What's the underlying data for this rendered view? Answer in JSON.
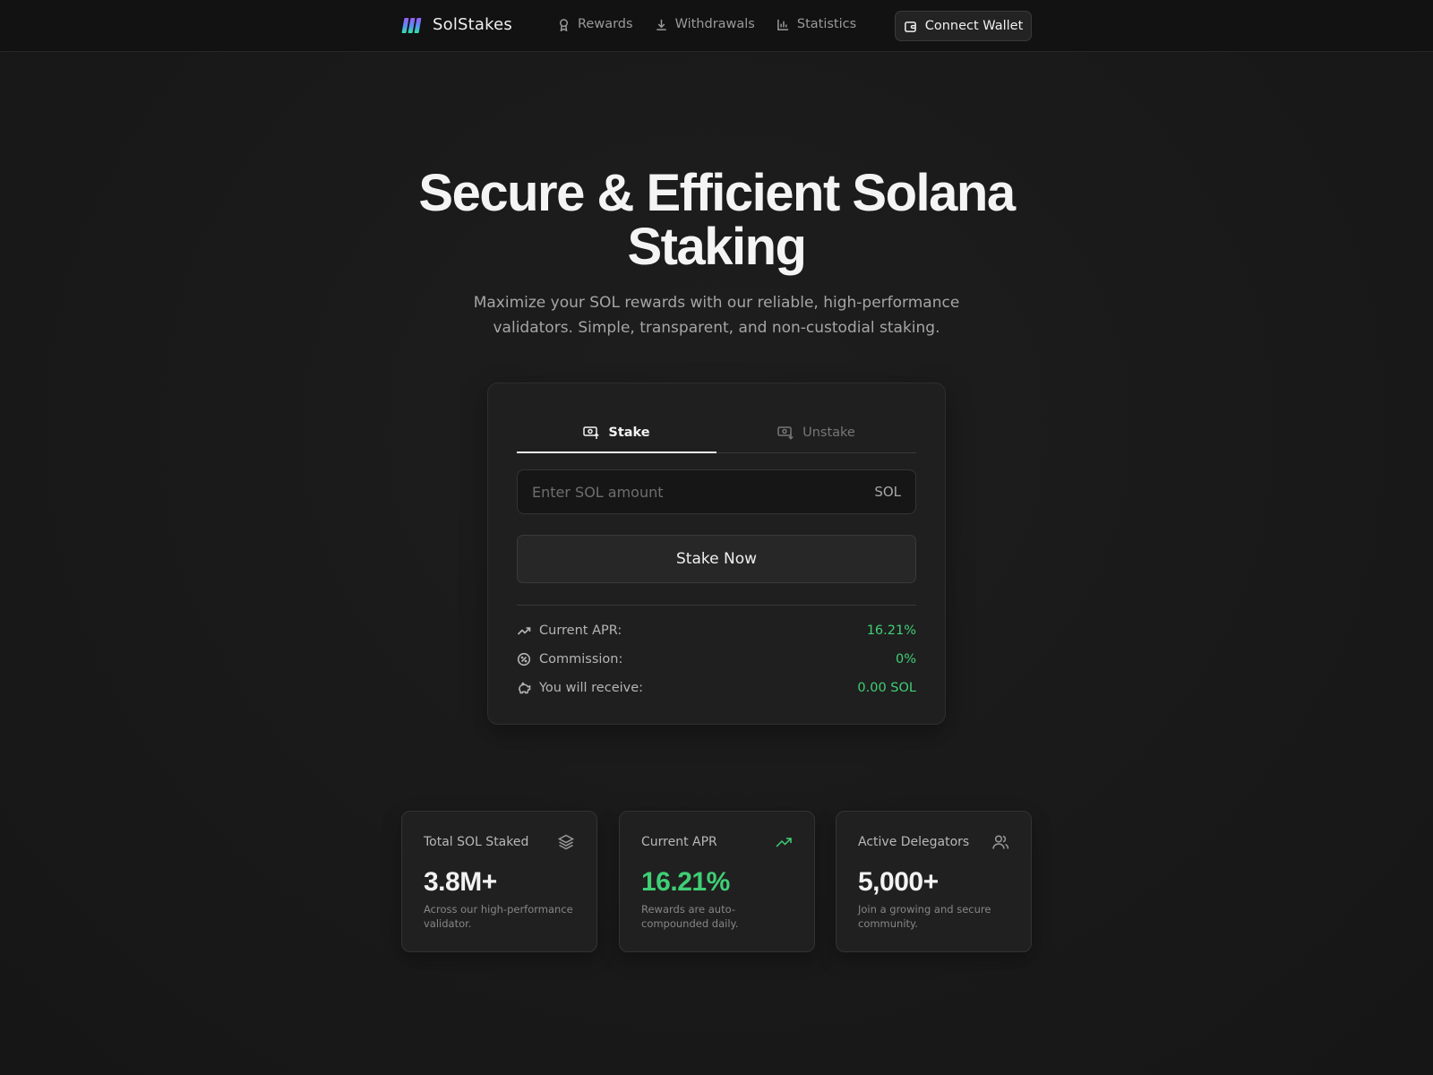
{
  "nav": {
    "brand": "SolStakes",
    "links": [
      {
        "label": "Rewards",
        "icon": "award-icon"
      },
      {
        "label": "Withdrawals",
        "icon": "download-icon"
      },
      {
        "label": "Statistics",
        "icon": "bar-chart-icon"
      }
    ],
    "wallet_button": "Connect Wallet"
  },
  "hero": {
    "title_line1": "Secure & Efficient Solana",
    "title_line2": "Staking",
    "subtitle_line1": "Maximize your SOL rewards with our reliable, high-performance",
    "subtitle_line2": "validators. Simple, transparent, and non-custodial staking."
  },
  "stake_card": {
    "tabs": [
      {
        "label": "Stake",
        "active": true
      },
      {
        "label": "Unstake",
        "active": false
      }
    ],
    "amount_placeholder": "Enter SOL amount",
    "amount_unit": "SOL",
    "stake_button": "Stake Now",
    "info": [
      {
        "label": "Current APR:",
        "value": "16.21%",
        "icon": "trending-up-icon"
      },
      {
        "label": "Commission:",
        "value": "0%",
        "icon": "percent-badge-icon"
      },
      {
        "label": "You will receive:",
        "value": "0.00 SOL",
        "icon": "piggy-bank-icon"
      }
    ]
  },
  "stats": [
    {
      "label": "Total SOL Staked",
      "value": "3.8M+",
      "desc": "Across our high-performance validator.",
      "icon": "layers-icon"
    },
    {
      "label": "Current APR",
      "value": "16.21%",
      "desc": "Rewards are auto-compounded daily.",
      "icon": "trending-up-icon"
    },
    {
      "label": "Active Delegators",
      "value": "5,000+",
      "desc": "Join a growing and secure community.",
      "icon": "users-icon"
    }
  ],
  "colors": {
    "accent_green": "#3fcf75",
    "background": "#1a1a1a",
    "logo_gradient": [
      "#9b5cf6",
      "#5b8cf6",
      "#2ee6a8"
    ]
  }
}
